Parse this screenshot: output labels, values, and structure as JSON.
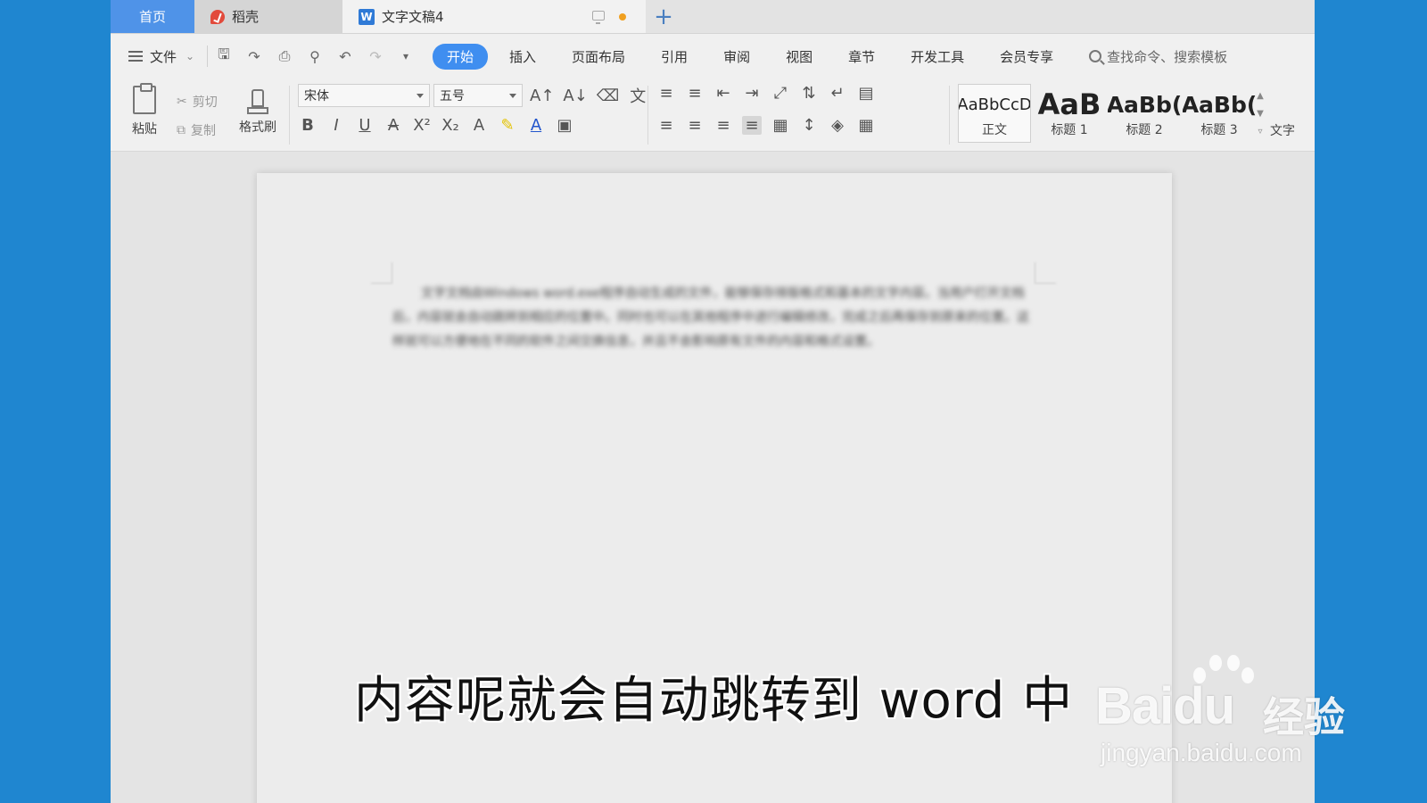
{
  "tabs": {
    "home": "首页",
    "daoke": "稻壳",
    "document": "文字文稿4",
    "add": "+"
  },
  "menu": {
    "file": "文件",
    "tabs": [
      "开始",
      "插入",
      "页面布局",
      "引用",
      "审阅",
      "视图",
      "章节",
      "开发工具",
      "会员专享"
    ],
    "active_tab": "开始",
    "search_placeholder": "查找命令、搜索模板"
  },
  "ribbon": {
    "paste": "粘贴",
    "cut": "剪切",
    "copy": "复制",
    "format_painter": "格式刷",
    "font_name": "宋体",
    "font_size": "五号",
    "styles": [
      {
        "preview": "AaBbCcD",
        "name": "正文"
      },
      {
        "preview": "AaB",
        "name": "标题 1"
      },
      {
        "preview": "AaBb(",
        "name": "标题 2"
      },
      {
        "preview": "AaBb(",
        "name": "标题 3"
      }
    ],
    "more": "文字"
  },
  "document": {
    "body_text": "文字文档由Windows word.exe程序自动生成的文件，能够保存排版格式和基本的文字内容。当用户打开文档后，内容就会自动跳转到相应的位置中。同时也可以在其他程序中进行编辑修改，完成之后再保存到原来的位置。这样就可以方便地在不同的软件之间交换信息，并且不会影响原有文件的内容和格式设置。"
  },
  "subtitle": "内容呢就会自动跳转到 word 中",
  "watermark": {
    "logo": "Baidu",
    "cn": "经验",
    "url": "jingyan.baidu.com"
  },
  "colors": {
    "background": "#1f86d0",
    "accent": "#3f8ef0",
    "home_tab": "#4f93e8"
  }
}
